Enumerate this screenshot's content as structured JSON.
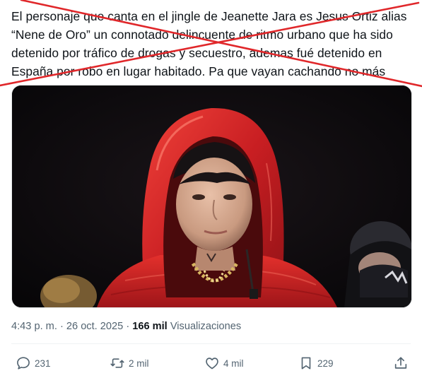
{
  "tweet": {
    "text_lines": [
      "El personaje que canta en el jingle de Jeanette Jara es Jesus Ortiz alias",
      "“Nene de Oro”  un connotado delincuente de ritmo urbano que ha sido",
      "detenido por tráfico de drogas y secuestro, ademas fué detenido en",
      "España por robo en lugar habitado.  Pa que vayan cachando no más"
    ],
    "time": "4:43 p. m.",
    "separator": "·",
    "date": "26 oct. 2025",
    "views_separator": "·",
    "views_count": "166 mil",
    "views_label": "Visualizaciones"
  },
  "actions": {
    "replies": "231",
    "reposts": "2 mil",
    "likes": "4 mil",
    "bookmarks": "229"
  },
  "colors": {
    "strike": "#e0272a",
    "meta_text": "#536471",
    "main_text": "#0f1419",
    "jacket": "#d8262a"
  },
  "icons": {
    "reply": "reply-icon",
    "repost": "repost-icon",
    "like": "heart-icon",
    "bookmark": "bookmark-icon",
    "share": "share-icon"
  }
}
